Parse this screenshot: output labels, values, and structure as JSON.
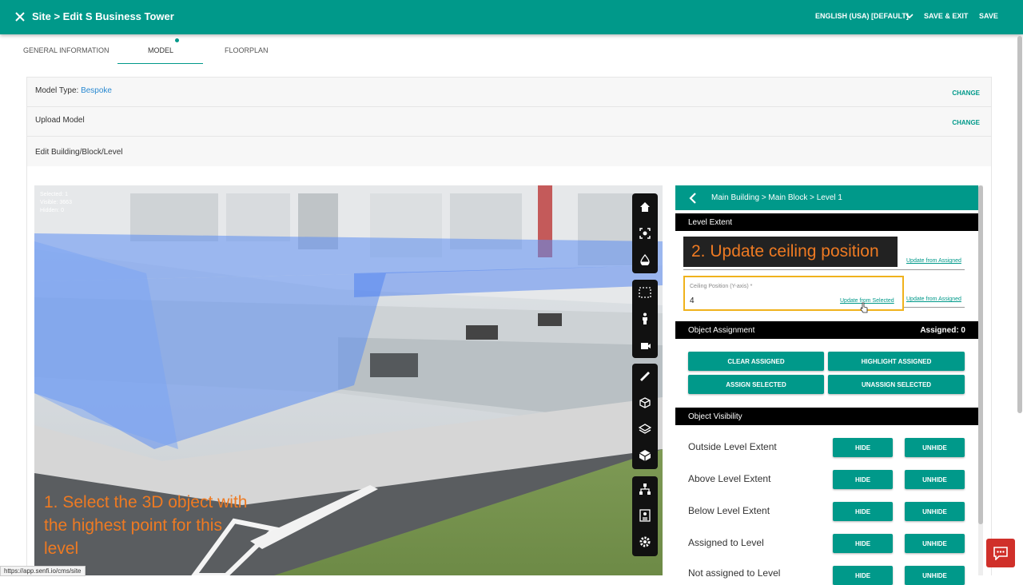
{
  "header": {
    "title": "Site > Edit S Business Tower",
    "language": "ENGLISH (USA) [DEFAULT]",
    "save_exit": "SAVE & EXIT",
    "save": "SAVE"
  },
  "tabs": [
    {
      "label": "GENERAL INFORMATION"
    },
    {
      "label": "MODEL"
    },
    {
      "label": "FLOORPLAN"
    }
  ],
  "sections": {
    "model_type_label": "Model Type:",
    "model_type_value": "Bespoke",
    "upload_model": "Upload Model",
    "edit_building": "Edit Building/Block/Level",
    "change": "CHANGE"
  },
  "viewport": {
    "stats": [
      "Selected: 1",
      "Visible: 3663",
      "Hidden: 0"
    ],
    "annotation": "1. Select the 3D object with the highest point for this level"
  },
  "panel": {
    "breadcrumb": "Main Building > Main Block > Level 1",
    "level_extent": "Level Extent",
    "annotation": "2. Update ceiling position",
    "update_from_assigned": "Update from Assigned",
    "update_from_selected": "Update from Selected",
    "ceiling_label": "Ceiling Position (Y-axis) *",
    "ceiling_value": "4",
    "object_assignment": "Object Assignment",
    "assigned": "Assigned: 0",
    "buttons": {
      "clear": "CLEAR ASSIGNED",
      "highlight": "HIGHLIGHT ASSIGNED",
      "assign": "ASSIGN SELECTED",
      "unassign": "UNASSIGN SELECTED"
    },
    "object_visibility": "Object Visibility",
    "visibility_rows": [
      {
        "label": "Outside Level Extent"
      },
      {
        "label": "Above Level Extent"
      },
      {
        "label": "Below Level Extent"
      },
      {
        "label": "Assigned to Level"
      },
      {
        "label": "Not assigned to Level"
      }
    ],
    "hide": "HIDE",
    "unhide": "UNHIDE"
  },
  "status_url": "https://app.senfi.io/cms/site",
  "colors": {
    "brand": "#00998a",
    "annotation": "#ee7a22",
    "highlight_box": "#f0b21c"
  }
}
